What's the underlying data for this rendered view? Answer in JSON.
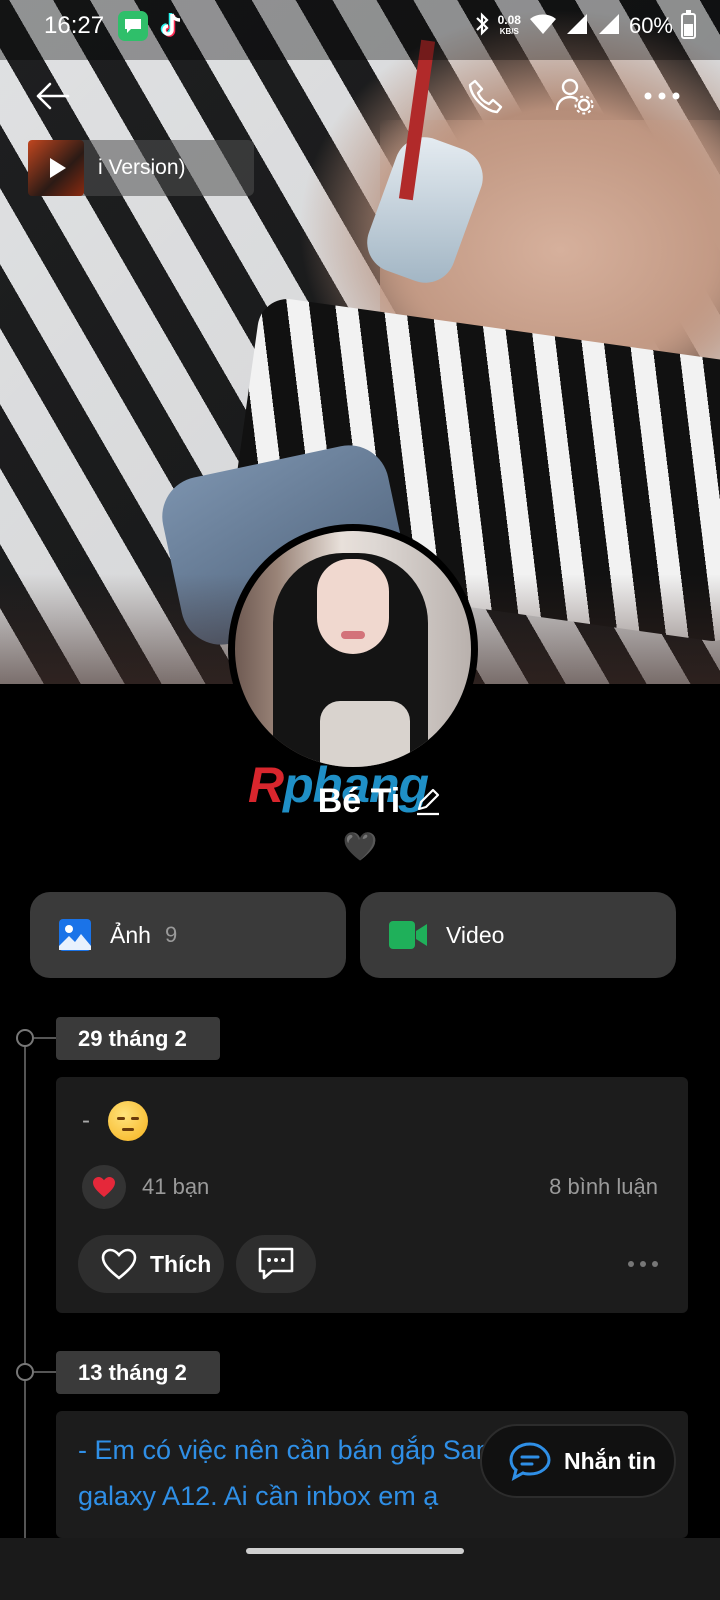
{
  "status_bar": {
    "time": "16:27",
    "net_speed": "0.08",
    "net_unit": "KB/S",
    "battery": "60%",
    "battery_level": 0.6
  },
  "music": {
    "title": "i Version)"
  },
  "profile": {
    "name": "Bé Ti",
    "bio": "🖤",
    "watermark_r": "R",
    "watermark_rest": "phang"
  },
  "media": {
    "photos_label": "Ảnh",
    "photos_count": "9",
    "video_label": "Video"
  },
  "posts": [
    {
      "date": "29 tháng 2",
      "text": "-",
      "reactions": "41 bạn",
      "comments": "8 bình luận",
      "like_label": "Thích"
    },
    {
      "date": "13 tháng 2",
      "text": "- Em có việc nên cần bán gắp Samsung galaxy A12. Ai cần inbox em ạ"
    }
  ],
  "fab": {
    "label": "Nhắn tin"
  },
  "colors": {
    "accent_blue": "#2f8fe6",
    "photo_icon": "#1a73e8",
    "video_icon": "#1fb05a",
    "heart": "#e5283a"
  }
}
